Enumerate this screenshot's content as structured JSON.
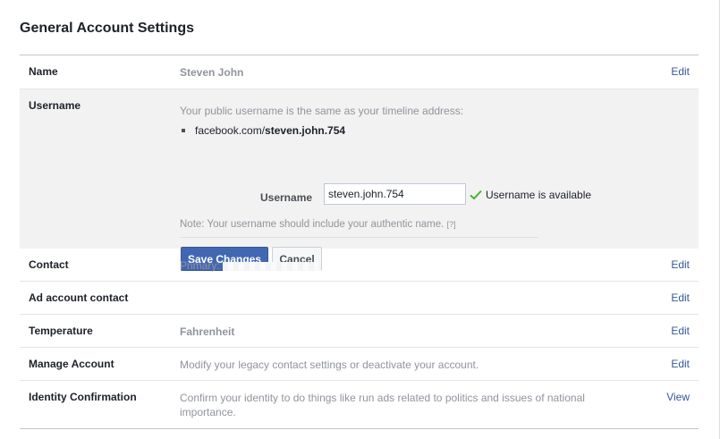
{
  "page": {
    "title": "General Account Settings"
  },
  "rows": [
    {
      "label": "Name",
      "value": "Steven John",
      "action": "Edit"
    },
    {
      "label": "Username",
      "description": "Your public username is the same as your timeline address:",
      "url_prefix": "facebook.com/",
      "url_username": "steven.john.754",
      "field_label": "Username",
      "field_value": "steven.john.754",
      "availability": "Username is available",
      "note": "Note: Your username should include your authentic name.",
      "note_help": "[?]",
      "save_label": "Save Changes",
      "cancel_label": "Cancel"
    },
    {
      "label": "Contact",
      "value": "Primary:",
      "action": "Edit"
    },
    {
      "label": "Ad account contact",
      "value": "",
      "action": "Edit"
    },
    {
      "label": "Temperature",
      "value": "Fahrenheit",
      "action": "Edit"
    },
    {
      "label": "Manage Account",
      "value": "Modify your legacy contact settings or deactivate your account.",
      "action": "Edit"
    },
    {
      "label": "Identity Confirmation",
      "value": "Confirm your identity to do things like run ads related to politics and issues of national importance.",
      "action": "View"
    }
  ],
  "colors": {
    "link": "#365899",
    "primary_button": "#4267b2",
    "available_check": "#42b72a"
  }
}
